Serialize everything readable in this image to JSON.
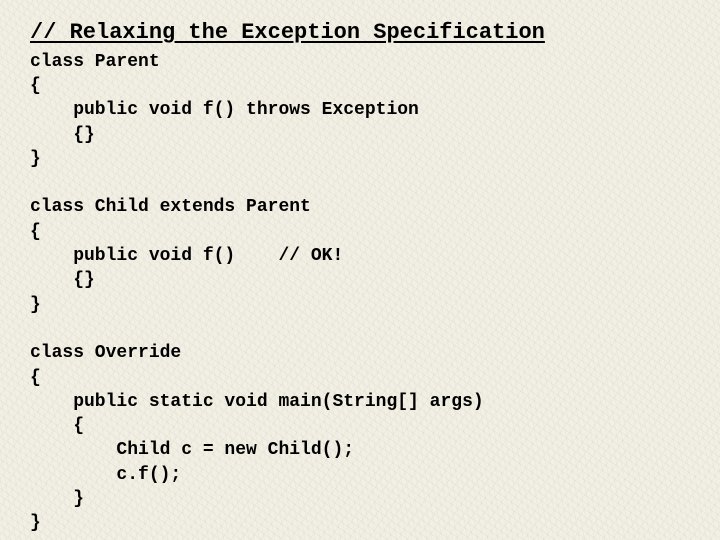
{
  "title": "// Relaxing the Exception Specification",
  "code": "class Parent\n{\n    public void f() throws Exception\n    {}\n}\n\nclass Child extends Parent\n{\n    public void f()    // OK!\n    {}\n}\n\nclass Override\n{\n    public static void main(String[] args)\n    {\n        Child c = new Child();\n        c.f();\n    }\n}"
}
